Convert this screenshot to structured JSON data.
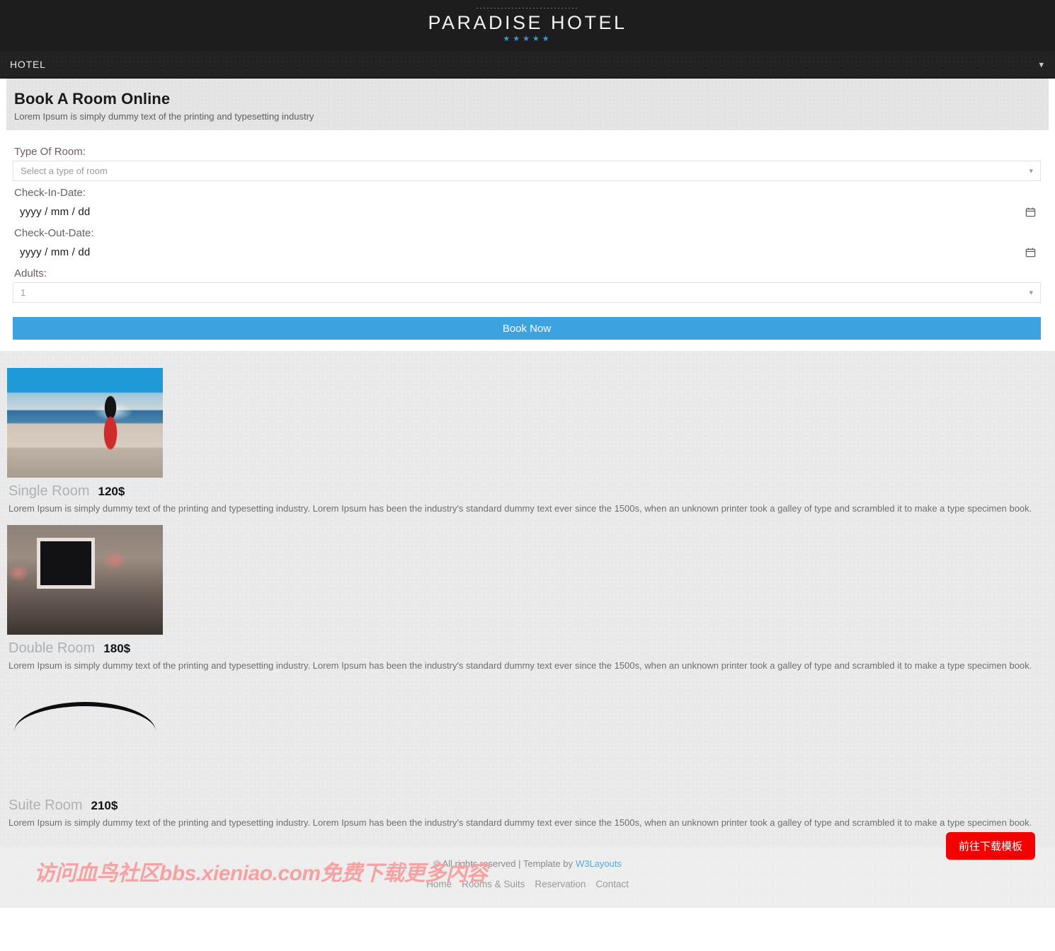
{
  "brand": {
    "logo_text": "PARADISE HOTEL",
    "stars": "★★★★★",
    "nav_brand": "HOTEL",
    "nav_toggle_icon": "chevron-down-icon"
  },
  "booking": {
    "title": "Book A Room Online",
    "subtitle": "Lorem Ipsum is simply dummy text of the printing and typesetting industry",
    "room_type_label": "Type Of Room:",
    "room_type_placeholder": "Select a type of room",
    "checkin_label": "Check-In-Date:",
    "checkin_value": "yyyy / mm / dd",
    "checkout_label": "Check-Out-Date:",
    "checkout_value": "yyyy / mm / dd",
    "adults_label": "Adults:",
    "adults_value": "1",
    "submit_label": "Book Now",
    "submit_color": "#3da3e0"
  },
  "rooms": [
    {
      "name": "Single Room",
      "price": "120$",
      "description": "Lorem Ipsum is simply dummy text of the printing and typesetting industry. Lorem Ipsum has been the industry's standard dummy text ever since the 1500s, when an unknown printer took a galley of type and scrambled it to make a type specimen book.",
      "image_alt": "seaside-dinner-photo"
    },
    {
      "name": "Double Room",
      "price": "180$",
      "description": "Lorem Ipsum is simply dummy text of the printing and typesetting industry. Lorem Ipsum has been the industry's standard dummy text ever since the 1500s, when an unknown printer took a galley of type and scrambled it to make a type specimen book.",
      "image_alt": "hotel-bedroom-photo"
    },
    {
      "name": "Suite Room",
      "price": "210$",
      "description": "Lorem Ipsum is simply dummy text of the printing and typesetting industry. Lorem Ipsum has been the industry's standard dummy text ever since the 1500s, when an unknown printer took a galley of type and scrambled it to make a type specimen book.",
      "image_alt": "underwater-suite-photo"
    }
  ],
  "footer": {
    "copyright": "© All rights reserved | Template by",
    "template_link": "W3Layouts",
    "nav": [
      "Home",
      "Rooms & Suits",
      "Reservation",
      "Contact"
    ],
    "watermark": "访问血鸟社区bbs.xieniao.com免费下载更多内容",
    "download_button": "前往下载模板",
    "download_button_color": "#f40000"
  }
}
